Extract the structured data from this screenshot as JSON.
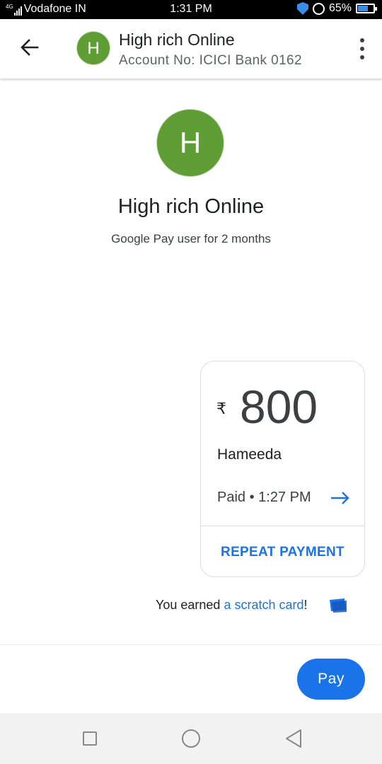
{
  "status_bar": {
    "network": "4G",
    "carrier": "Vodafone IN",
    "time": "1:31 PM",
    "battery": "65%",
    "battery_level": 0.65,
    "icons": [
      "signal-icon",
      "shield-icon",
      "lock-icon",
      "battery-icon"
    ]
  },
  "header": {
    "avatar_letter": "H",
    "title": "High rich Online",
    "subtitle": "Account No: ICICI Bank 0162",
    "avatar_color": "#5f9e35"
  },
  "profile": {
    "avatar_letter": "H",
    "name": "High rich Online",
    "meta": "Google Pay user for 2 months"
  },
  "payment": {
    "currency_symbol": "₹",
    "amount": "800",
    "note": "Hameeda",
    "status": "Paid • 1:27 PM",
    "repeat_label": "REPEAT PAYMENT"
  },
  "reward": {
    "prefix": "You earned ",
    "link": "a scratch card",
    "suffix": "!"
  },
  "actions": {
    "pay_label": "Pay"
  },
  "colors": {
    "accent": "#1a73e8",
    "avatar": "#5f9e35"
  }
}
